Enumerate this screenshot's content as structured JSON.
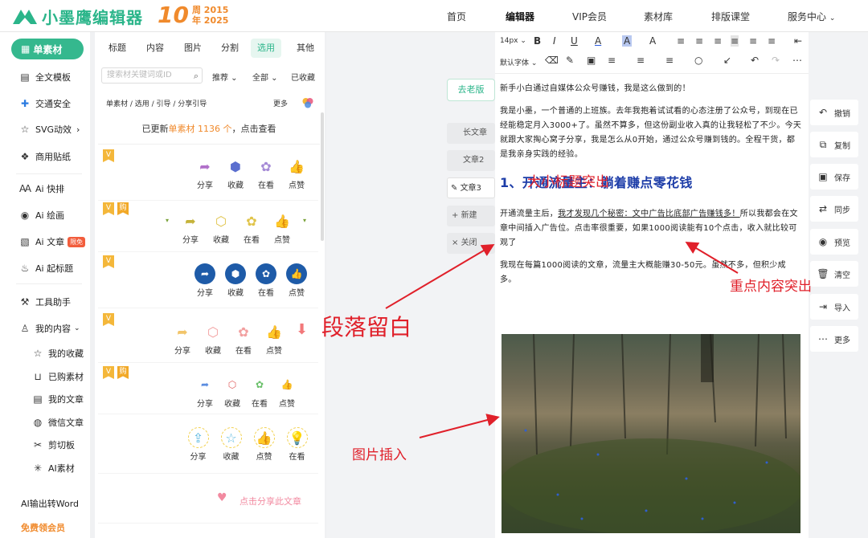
{
  "brand": {
    "name": "小墨鹰编辑器",
    "anniv_num": "10",
    "anniv_line1": "周 2015",
    "anniv_line2": "年 2025",
    "accent": "#2bb58a"
  },
  "nav": [
    "首页",
    "编辑器",
    "VIP会员",
    "素材库",
    "排版课堂",
    "服务中心"
  ],
  "sidebar": {
    "items": [
      {
        "label": "单素材",
        "icon": "grid-icon"
      },
      {
        "label": "全文模板",
        "icon": "book-icon"
      },
      {
        "label": "交通安全",
        "icon": "road-icon"
      },
      {
        "label": "SVG动效",
        "icon": "star-icon"
      },
      {
        "label": "商用贴纸",
        "icon": "sticker-icon"
      },
      {
        "label": "Ai 快排",
        "icon": "ai-icon"
      },
      {
        "label": "Ai 绘画",
        "icon": "palette-icon"
      },
      {
        "label": "Ai 文章",
        "icon": "doc-icon"
      },
      {
        "label": "Ai 起标题",
        "icon": "fire-icon"
      },
      {
        "label": "工具助手",
        "icon": "toolbox-icon"
      },
      {
        "label": "我的内容",
        "icon": "user-icon"
      },
      {
        "label": "我的收藏",
        "icon": "star-outline-icon"
      },
      {
        "label": "已购素材",
        "icon": "cart-icon"
      },
      {
        "label": "我的文章",
        "icon": "article-icon"
      },
      {
        "label": "微信文章",
        "icon": "wechat-icon"
      },
      {
        "label": "剪切板",
        "icon": "scissors-icon"
      },
      {
        "label": "AI素材",
        "icon": "sparkle-icon"
      },
      {
        "label": "AI输出转Word",
        "icon": ""
      },
      {
        "label": "免费领会员",
        "icon": ""
      }
    ],
    "free_badge": "限免"
  },
  "panel": {
    "tabs": [
      "标题",
      "内容",
      "图片",
      "分割",
      "选用",
      "其他"
    ],
    "search_placeholder": "搜索材关键词或ID",
    "filters": [
      "推荐",
      "全部",
      "已收藏"
    ],
    "breadcrumb": "单素材 / 选用 / 引导 / 分享引导",
    "more": "更多",
    "updated_prefix": "已更新",
    "updated_hl": "单素材 1136 个",
    "updated_suffix": "，点击查看",
    "btn_labels": [
      "分享",
      "收藏",
      "在看",
      "点赞"
    ],
    "btn_labels_b": [
      "分享",
      "收藏",
      "点赞",
      "在看"
    ],
    "share_article": "点击分享此文章"
  },
  "editor": {
    "old_version": "去老版",
    "article_tabs": [
      "长文章",
      "文章2",
      "文章3",
      "新建",
      "关闭"
    ],
    "toolbar_row1": [
      "14px",
      "B",
      "I",
      "U",
      "A",
      "A",
      "A",
      "≡",
      "≡",
      "≡",
      "≡",
      "≡",
      "≡",
      "⇤"
    ],
    "toolbar_row2": [
      "默认字体",
      "⌫",
      "✎",
      "▣",
      "≡",
      "≡",
      "≡",
      "○",
      "↙",
      "↶",
      "↷",
      "⋯"
    ],
    "p1": "新手小白通过自媒体公众号赚钱，我是这么做到的！",
    "p2": "我是小墨，一个普通的上班族。去年我抱着试试看的心态注册了公众号，到现在已经能稳定月入3000+了。虽然不算多，但这份副业收入真的让我轻松了不少。今天就跟大家掏心窝子分享，我是怎么从0开始，通过公众号赚到钱的。全程干货，都是我亲身实践的经验。",
    "heading": "1、开通流量主：躺着赚点零花钱",
    "p3_a": "开通流量主后，",
    "p3_b": "我才发现几个秘密：文中广告比底部广告赚钱多！",
    "p3_c": "所以我都会在文章中间插入广告位。点击率很重要，如果1000阅读能有10个点击，收入就比较可观了",
    "p4": "我现在每篇1000阅读的文章，流量主大概能赚30-50元。虽然不多，但积少成多。"
  },
  "right_actions": [
    "撤销",
    "复制",
    "保存",
    "同步",
    "预览",
    "清空",
    "导入",
    "更多"
  ],
  "annotations": {
    "heading": "大小标题突出",
    "key": "重点内容突出",
    "para": "段落留白",
    "image": "图片插入",
    "color": "#e0202a"
  }
}
